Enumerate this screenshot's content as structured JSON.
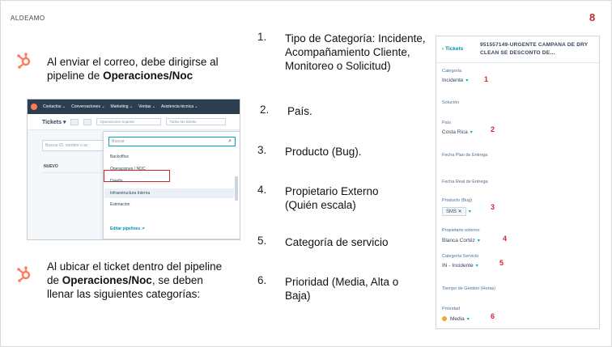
{
  "brand": "ALDEAMO",
  "page_number": "8",
  "note1": {
    "pre": "Al enviar el correo, debe dirigirse al pipeline de ",
    "bold": "Operaciones/Noc"
  },
  "note2": {
    "pre": "Al ubicar el ticket dentro del pipeline de ",
    "bold": "Operaciones/Noc",
    "post": ", se deben llenar las siguientes categorías:"
  },
  "screenshot": {
    "nav": [
      "Contactos ⌄",
      "Conversaciones ⌄",
      "Marketing ⌄",
      "Ventas ⌄",
      "Asistencia técnica ⌄"
    ],
    "tickets_label": "Tickets ▾",
    "pipeline_select": "Operaciones Soporte",
    "filter_select": "Todos los tickets",
    "search_placeholder": "Buscar ID, nombre o ac",
    "column_new": "NUEVO",
    "menu_search": "Buscar",
    "menu_items": [
      "Backoffice",
      "Operaciones / NOC",
      "Diseño",
      "Infraestructura Interna",
      "Estimación"
    ],
    "menu_edit": "Editar pipelines ↗",
    "accent": "#d9242c"
  },
  "list": [
    {
      "n": "1.",
      "text": "Tipo de Categoría: Incidente, Acompañamiento Cliente, Monitoreo o Solicitud)"
    },
    {
      "n": "2.",
      "text": "País."
    },
    {
      "n": "3.",
      "text": "Producto (Bug)."
    },
    {
      "n": "4.",
      "text": "Propietario Externo (Quién escala)"
    },
    {
      "n": "5.",
      "text": "Categoría de servicio"
    },
    {
      "n": "6.",
      "text": "Prioridad (Media, Alta o Baja)"
    }
  ],
  "panel": {
    "back": "‹ Tickets",
    "title": "951557149-URGENTE CAMPANA DE DRY CLEAN SE DESCONTO DE…",
    "fields": [
      {
        "label": "Categoría",
        "value": "Incidente",
        "marker": "1"
      },
      {
        "label": "Solución",
        "value": ""
      },
      {
        "label": "País",
        "value": "Costa Rica",
        "marker": "2"
      },
      {
        "label": "Fecha Plan de Entrega",
        "value": ""
      },
      {
        "label": "Fecha Real de Entrega",
        "value": ""
      },
      {
        "label": "Producto (Bug)",
        "value": "SMS",
        "marker": "3"
      },
      {
        "label": "Propietario externo",
        "value": "Blanca Cortéz",
        "marker": "4"
      },
      {
        "label": "Categoría Servicio",
        "value": "IN - Incidente",
        "marker": "5"
      },
      {
        "label": "Tiempo de Gestión (Horas)",
        "value": ""
      },
      {
        "label": "Prioridad",
        "value": "Media",
        "marker": "6"
      }
    ]
  }
}
